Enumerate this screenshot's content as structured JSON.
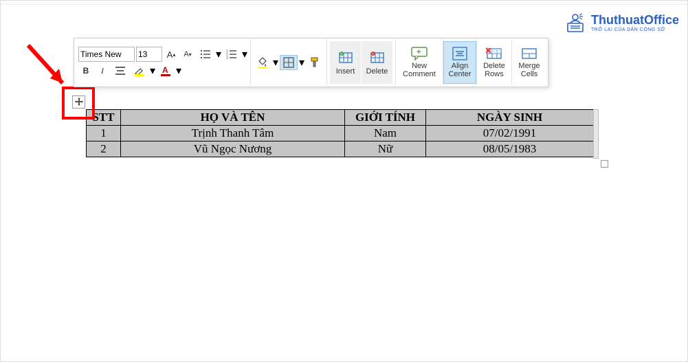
{
  "watermark": {
    "name": "ThuthuatOffice",
    "sub": "TRỞ LẠI CỦA DÂN CÔNG SỞ"
  },
  "toolbar": {
    "font_name": "Times New",
    "font_size": "13",
    "insert_label": "Insert",
    "delete_label": "Delete",
    "new_comment_label_1": "New",
    "new_comment_label_2": "Comment",
    "align_center_label_1": "Align",
    "align_center_label_2": "Center",
    "delete_rows_label_1": "Delete",
    "delete_rows_label_2": "Rows",
    "merge_cells_label_1": "Merge",
    "merge_cells_label_2": "Cells"
  },
  "table": {
    "headers": {
      "stt": "STT",
      "name": "HỌ VÀ TÊN",
      "gender": "GIỚI TÍNH",
      "dob": "NGÀY SINH"
    },
    "rows": [
      {
        "stt": "1",
        "name": "Trịnh Thanh Tâm",
        "gender": "Nam",
        "dob": "07/02/1991"
      },
      {
        "stt": "2",
        "name": "Vũ Ngọc Nương",
        "gender": "Nữ",
        "dob": "08/05/1983"
      }
    ]
  }
}
